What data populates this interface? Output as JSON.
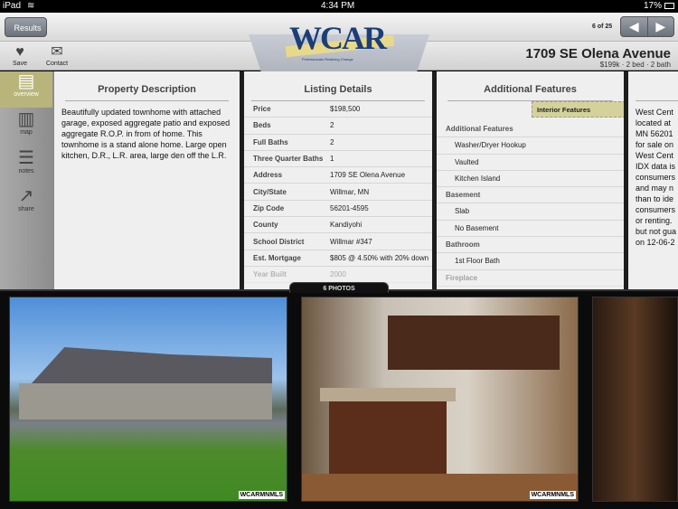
{
  "status": {
    "device": "iPad",
    "time": "4:34 PM",
    "battery": "17%"
  },
  "toolbar": {
    "back_label": "Results",
    "logo_text": "WCAR",
    "logo_tagline": "West Central Association of Realtors",
    "logo_sub": "Professionals Realizing Change",
    "counter": "6 of 25",
    "save_label": "Save",
    "contact_label": "Contact",
    "address": "1709 SE Olena Avenue",
    "summary": "$199k · 2 bed · 2 bath"
  },
  "sidebar": {
    "items": [
      {
        "label": "overview",
        "icon": "overview-icon"
      },
      {
        "label": "map",
        "icon": "map-icon"
      },
      {
        "label": "notes",
        "icon": "notes-icon"
      },
      {
        "label": "share",
        "icon": "share-icon"
      }
    ]
  },
  "description": {
    "title": "Property Description",
    "text": "Beautifully updated townhome with attached garage, exposed aggregate patio and exposed aggregate R.O.P. in from of home. This townhome is a stand alone home. Large open kitchen, D.R., L.R. area, large den off the L.R."
  },
  "details": {
    "title": "Listing Details",
    "rows": [
      {
        "k": "Price",
        "v": "$198,500"
      },
      {
        "k": "Beds",
        "v": "2"
      },
      {
        "k": "Full Baths",
        "v": "2"
      },
      {
        "k": "Three Quarter Baths",
        "v": "1"
      },
      {
        "k": "Address",
        "v": "1709 SE Olena Avenue"
      },
      {
        "k": "City/State",
        "v": "Willmar, MN"
      },
      {
        "k": "Zip Code",
        "v": "56201-4595"
      },
      {
        "k": "County",
        "v": "Kandiyohi"
      },
      {
        "k": "School District",
        "v": "Willmar #347"
      },
      {
        "k": "Est. Mortgage",
        "v": "$805 @ 4.50% with 20% down"
      },
      {
        "k": "Year Built",
        "v": "2000"
      }
    ]
  },
  "features": {
    "title": "Additional Features",
    "filter": "Interior Features",
    "rows": [
      {
        "t": "Additional Features",
        "h": true
      },
      {
        "t": "Washer/Dryer Hookup"
      },
      {
        "t": "Vaulted"
      },
      {
        "t": "Kitchen Island"
      },
      {
        "t": "Basement",
        "h": true
      },
      {
        "t": "Slab"
      },
      {
        "t": "No Basement"
      },
      {
        "t": "Bathroom",
        "h": true
      },
      {
        "t": "1st Floor Bath"
      },
      {
        "t": "Fireplace",
        "h": true
      }
    ]
  },
  "disclaimer": {
    "lines": [
      "West Cent",
      "located at",
      "MN 56201",
      "for sale on",
      "West Cent",
      "IDX data is",
      "consumers",
      "and may n",
      "than to ide",
      "consumers",
      "or renting.",
      "but not gua",
      "on 12-06-2"
    ]
  },
  "photos": {
    "label": "6 PHOTOS",
    "watermark": "WCARMNMLS"
  }
}
